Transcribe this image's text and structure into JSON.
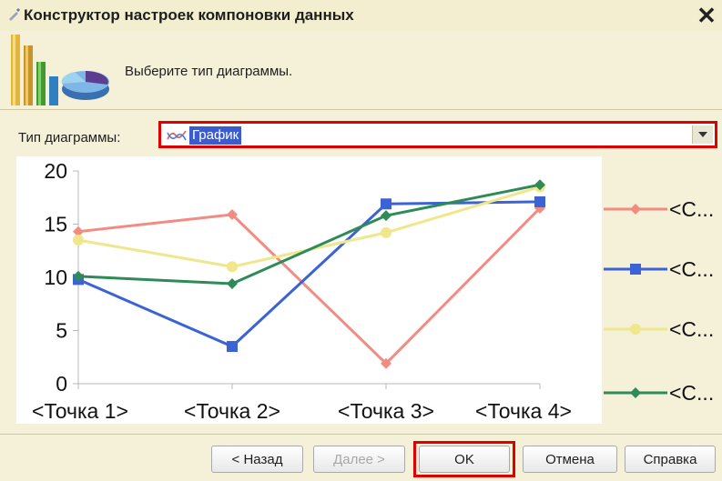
{
  "window": {
    "title": "Конструктор настроек компоновки данных",
    "close_label": "✕"
  },
  "header": {
    "prompt": "Выберите тип диаграммы."
  },
  "chart_type": {
    "label": "Тип диаграммы:",
    "value": "График"
  },
  "chart_data": {
    "type": "line",
    "categories": [
      "<Точка 1>",
      "<Точка 2>",
      "<Точка 3>",
      "<Точка 4>"
    ],
    "ylim": [
      0,
      20
    ],
    "yticks": [
      0,
      5,
      10,
      15,
      20
    ],
    "series": [
      {
        "label": "<С...",
        "color": "#f28b82",
        "marker": "diamond",
        "values": [
          14.3,
          15.9,
          1.9,
          16.5
        ]
      },
      {
        "label": "<С...",
        "color": "#3b63d6",
        "marker": "square",
        "values": [
          9.8,
          3.5,
          16.9,
          17.1
        ]
      },
      {
        "label": "<С...",
        "color": "#f0e68c",
        "marker": "circle",
        "values": [
          13.5,
          11.0,
          14.2,
          18.5
        ]
      },
      {
        "label": "<С...",
        "color": "#2e8b57",
        "marker": "diamond",
        "values": [
          10.1,
          9.4,
          15.8,
          18.7
        ]
      }
    ]
  },
  "buttons": {
    "back": "< Назад",
    "next": "Далее >",
    "ok": "OK",
    "cancel": "Отмена",
    "help": "Справка"
  }
}
